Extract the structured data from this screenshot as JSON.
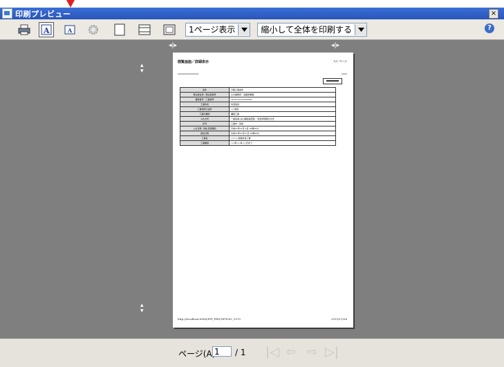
{
  "window": {
    "title": "印刷プレビュー",
    "close_label": "×"
  },
  "toolbar": {
    "view_select": "1ページ表示",
    "scale_select": "縮小して全体を印刷する",
    "help_label": "?",
    "icons": [
      "print-icon",
      "font-large-icon",
      "font-small-icon",
      "settings-icon",
      "page-view-icon",
      "header-footer-icon",
      "fit-page-icon"
    ]
  },
  "page": {
    "header_title": "閲覧画面／詳細表示",
    "header_page": "1/1 ページ",
    "footer_url": "http://localhost:8080/PPI_PRG/GP9005_1070",
    "footer_date": "2015/11/06",
    "rows": [
      {
        "k": "案件",
        "v": "日程工事案件"
      },
      {
        "k": "発注者名称／発注者番号",
        "v": "土木事務所／道路整備課"
      },
      {
        "k": "業務番号／工事番号",
        "v": "1111111111222222"
      },
      {
        "k": "工事件名",
        "v": "市道改良"
      },
      {
        "k": "工事場所の住所",
        "v": "○○地区"
      },
      {
        "k": "工事の種別",
        "v": "舗装工事"
      },
      {
        "k": "入札方式",
        "v": "一般競争入札(事後審査型)・総合評価落札方式"
      },
      {
        "k": "状況",
        "v": "工事中・完成"
      },
      {
        "k": "入札日時／開札日時期間",
        "v": "平成27年11月 5日 10時00分"
      },
      {
        "k": "契約日時",
        "v": "平成27年11月17日 10時00分"
      },
      {
        "k": "工事名",
        "v": "○○○○道路改良工事"
      },
      {
        "k": "工事期間",
        "v": "○○年○○月○○日まで"
      }
    ]
  },
  "statusbar": {
    "page_label": "ページ(A)",
    "page_value": "1",
    "page_total": "/ 1"
  }
}
